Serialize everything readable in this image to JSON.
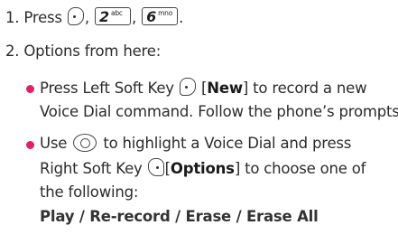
{
  "step1": {
    "number": "1.",
    "press_text": "Press",
    "sep1": ",",
    "sep2": ",",
    "end": ".",
    "key2": {
      "digit": "2",
      "letters": "abc"
    },
    "key6": {
      "digit": "6",
      "letters": "mno"
    }
  },
  "step2": {
    "number": "2.",
    "text": "Options from here:"
  },
  "bullet1": {
    "line1_pre": "Press Left Soft Key",
    "bracket_open": "[",
    "new_label": "New",
    "line1_post": "] to record a new",
    "line2": "Voice Dial command. Follow the phone’s prompts."
  },
  "bullet2": {
    "line1_pre": "Use",
    "line1_post": "to highlight a Voice Dial and press",
    "line2_pre": "Right Soft Key",
    "bracket_open": "[",
    "options_label": "Options",
    "line2_post": "] to choose one of",
    "line3": "the following:",
    "line4": "Play / Re-record / Erase / Erase All"
  },
  "colors": {
    "bullet": "#e2206a",
    "text": "#2b2b2b"
  },
  "icons": [
    "left-soft-key-icon",
    "key-2-icon",
    "key-6-icon",
    "navigation-key-icon",
    "right-soft-key-icon"
  ]
}
